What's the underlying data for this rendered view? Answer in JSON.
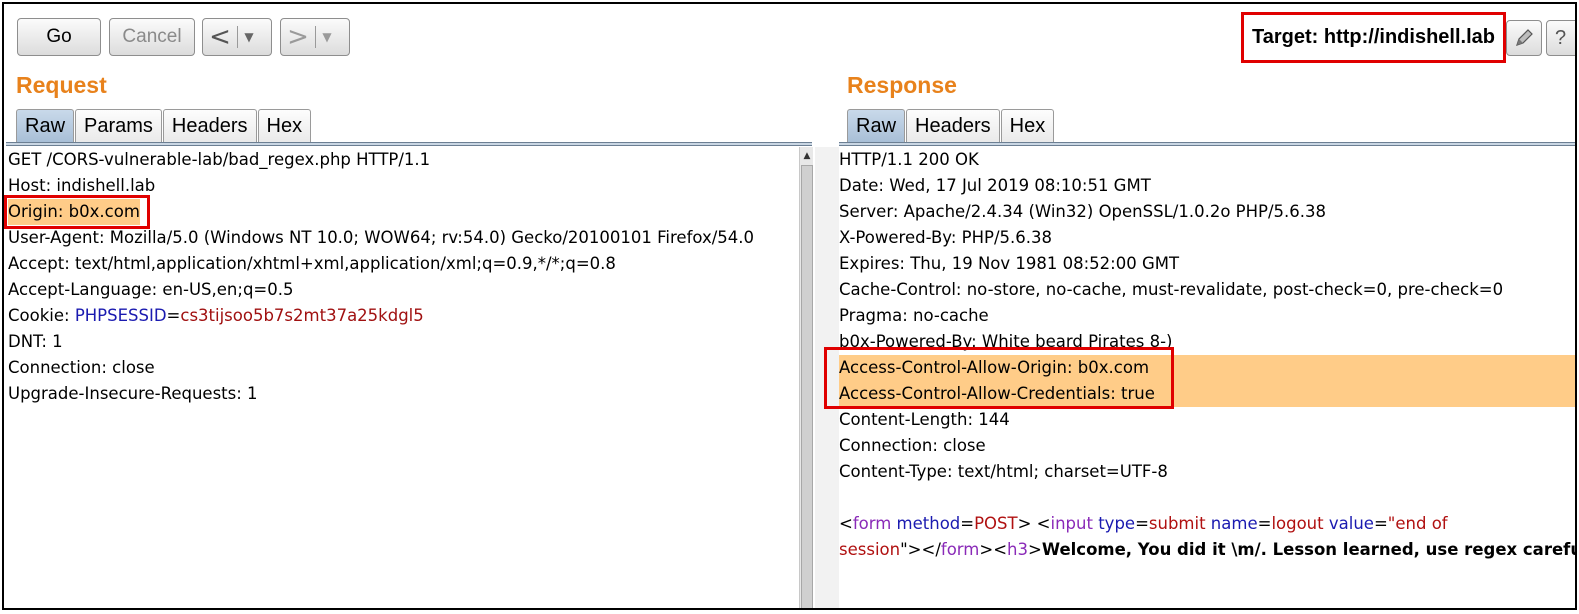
{
  "toolbar": {
    "go_label": "Go",
    "cancel_label": "Cancel",
    "back_glyph": "<",
    "forward_glyph": ">",
    "dropdown_glyph": "▼",
    "target_label": "Target: http://indishell.lab",
    "edit_icon": "pencil-icon",
    "help_glyph": "?"
  },
  "request": {
    "title": "Request",
    "tabs": [
      "Raw",
      "Params",
      "Headers",
      "Hex"
    ],
    "active_tab": "Raw",
    "lines": [
      "GET /CORS-vulnerable-lab/bad_regex.php HTTP/1.1",
      "Host: indishell.lab",
      "Origin: b0x.com",
      "User-Agent: Mozilla/5.0 (Windows NT 10.0; WOW64; rv:54.0) Gecko/20100101 Firefox/54.0",
      "Accept: text/html,application/xhtml+xml,application/xml;q=0.9,*/*;q=0.8",
      "Accept-Language: en-US,en;q=0.5",
      "Cookie: ",
      "DNT: 1",
      "Connection: close",
      "Upgrade-Insecure-Requests: 1"
    ],
    "cookie_name": "PHPSESSID",
    "cookie_eq": "=",
    "cookie_value": "cs3tijsoo5b7s2mt37a25kdgl5"
  },
  "response": {
    "title": "Response",
    "tabs": [
      "Raw",
      "Headers",
      "Hex"
    ],
    "active_tab": "Raw",
    "lines": [
      "HTTP/1.1 200 OK",
      "Date: Wed, 17 Jul 2019 08:10:51 GMT",
      "Server: Apache/2.4.34 (Win32) OpenSSL/1.0.2o PHP/5.6.38",
      "X-Powered-By: PHP/5.6.38",
      "Expires: Thu, 19 Nov 1981 08:52:00 GMT",
      "Cache-Control: no-store, no-cache, must-revalidate, post-check=0, pre-check=0",
      "Pragma: no-cache",
      "b0x-Powered-By: White beard Pirates 8-)",
      "Access-Control-Allow-Origin: b0x.com",
      "Access-Control-Allow-Credentials: true",
      "Content-Length: 144",
      "Connection: close",
      "Content-Type: text/html; charset=UTF-8"
    ],
    "body": {
      "l1_lt": "<",
      "l1_form": "form",
      "l1_method_attr": " method",
      "l1_eq1": "=",
      "l1_method_val": "POST",
      "l1_gt_lt": "> <",
      "l1_input": "input",
      "l1_type_attr": " type",
      "l1_eq2": "=",
      "l1_type_val": "submit",
      "l1_name_attr": " name",
      "l1_eq3": "=",
      "l1_name_val": "logout",
      "l1_value_attr": " value",
      "l1_eq4": "=",
      "l1_value_val": "\"end of",
      "l2_value_val": "session",
      "l2_quote": "\"",
      "l2_gt_lt_slash": "></",
      "l2_form": "form",
      "l2_gt_lt": "><",
      "l2_h3": "h3",
      "l2_gt": ">",
      "l2_text": "Welcome, You did it \\m/. Lesson learned, use regex carefully"
    }
  }
}
